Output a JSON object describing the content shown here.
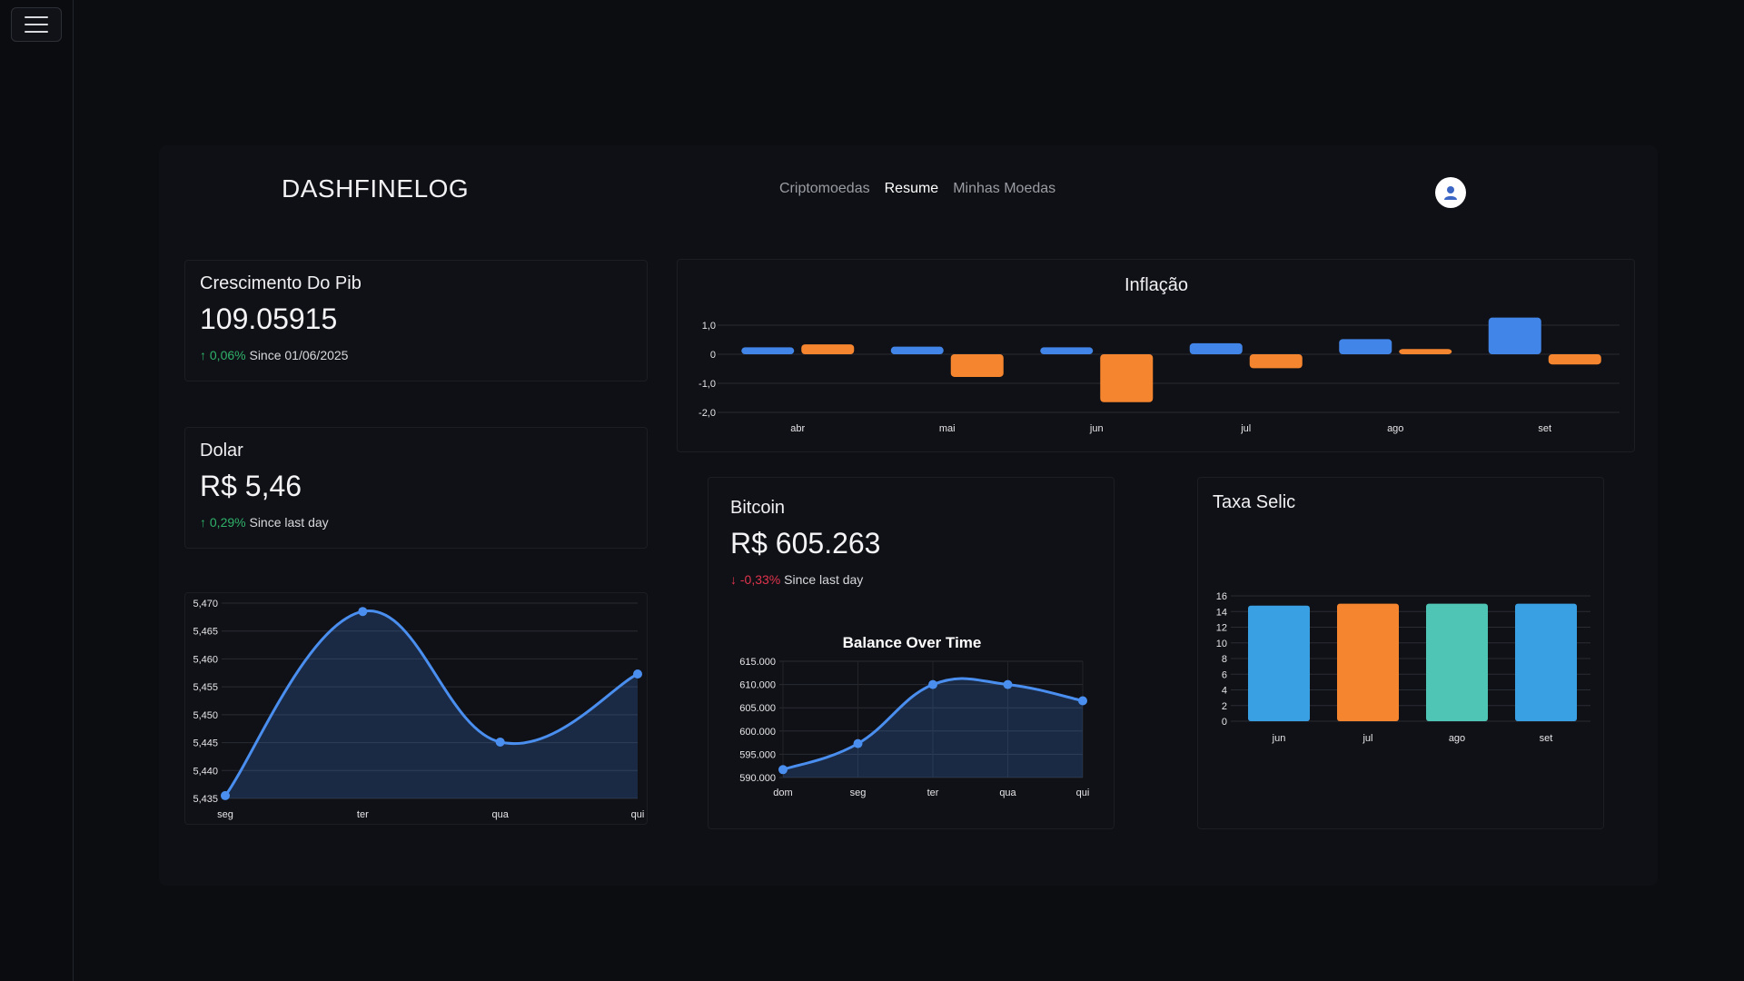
{
  "header": {
    "brand": "DASHFINELOG",
    "nav": [
      "Criptomoedas",
      "Resume",
      "Minhas Moedas"
    ],
    "active_nav": "Resume"
  },
  "cards": {
    "pib": {
      "title": "Crescimento Do Pib",
      "value": "109.05915",
      "delta_arrow": "↑",
      "delta": "0,06%",
      "since": "Since 01/06/2025"
    },
    "dolar": {
      "title": "Dolar",
      "value": "R$ 5,46",
      "delta_arrow": "↑",
      "delta": "0,29%",
      "since": "Since last day"
    },
    "bitcoin": {
      "title": "Bitcoin",
      "value": "R$ 605.263",
      "delta_arrow": "↓",
      "delta": "-0,33%",
      "since": "Since last day"
    },
    "selic": {
      "title": "Taxa Selic"
    },
    "inflacao": {
      "title": "Inflação"
    }
  },
  "colors": {
    "blue": "#4285e8",
    "orange": "#f5852f",
    "teal": "#4fc5b5",
    "sky": "#3aa0e4",
    "up": "#2fb16a",
    "down": "#e0344d"
  },
  "chart_data": [
    {
      "id": "inflacao",
      "type": "bar",
      "title": "Inflação",
      "categories": [
        "abr",
        "mai",
        "jun",
        "jul",
        "ago",
        "set"
      ],
      "series": [
        {
          "values": [
            0.24,
            0.26,
            0.24,
            0.38,
            0.52,
            1.26
          ]
        },
        {
          "values": [
            0.34,
            -0.78,
            -1.65,
            -0.48,
            0.18,
            -0.35
          ]
        }
      ],
      "yticks": [
        "1,0",
        "0",
        "-1,0",
        "-2,0"
      ],
      "ylim": [
        -2.0,
        1.0
      ],
      "grid": true
    },
    {
      "id": "dolar",
      "type": "area",
      "categories": [
        "seg",
        "ter",
        "qua",
        "qui"
      ],
      "values": [
        5.4355,
        5.4685,
        5.4451,
        5.4573
      ],
      "yticks": [
        "5,470",
        "5,465",
        "5,460",
        "5,455",
        "5,450",
        "5,445",
        "5,440",
        "5,435"
      ],
      "ylim": [
        5.435,
        5.47
      ],
      "grid": true
    },
    {
      "id": "bitcoin",
      "type": "area",
      "title": "Balance Over Time",
      "categories": [
        "dom",
        "seg",
        "ter",
        "qua",
        "qui"
      ],
      "values": [
        591700,
        597300,
        610000,
        610000,
        606500
      ],
      "yticks": [
        "615.000",
        "610.000",
        "605.000",
        "600.000",
        "595.000",
        "590.000"
      ],
      "ylim": [
        590000,
        615000
      ],
      "grid": true
    },
    {
      "id": "selic",
      "type": "bar",
      "title": "Taxa Selic",
      "categories": [
        "jun",
        "jul",
        "ago",
        "set"
      ],
      "values": [
        14.75,
        15,
        15,
        15
      ],
      "yticks": [
        "16",
        "14",
        "12",
        "10",
        "8",
        "6",
        "4",
        "2",
        "0"
      ],
      "ylim": [
        0,
        16
      ],
      "grid": true
    }
  ]
}
